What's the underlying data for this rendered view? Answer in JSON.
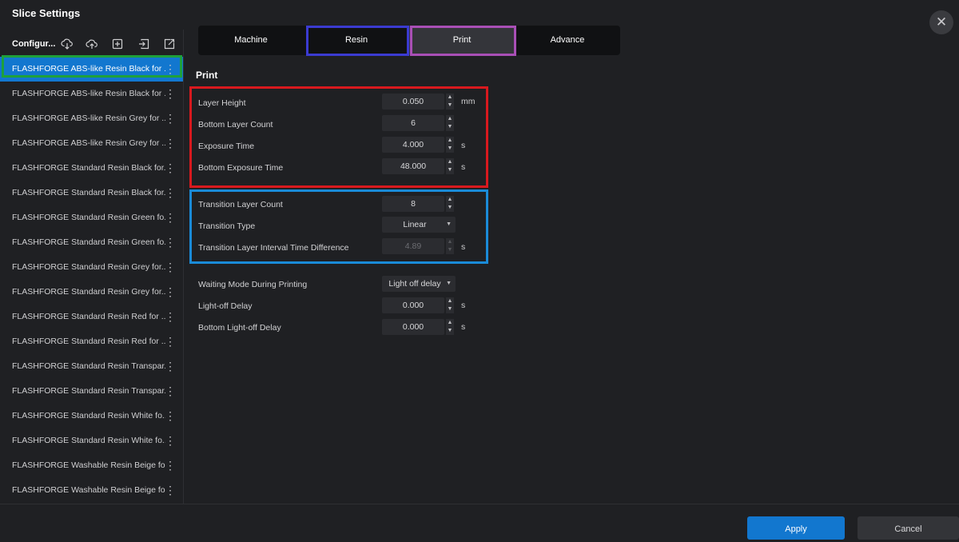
{
  "window": {
    "title": "Slice Settings",
    "close_glyph": "✕"
  },
  "sidebar": {
    "header_title": "Configur...",
    "icons": [
      "download-cloud-icon",
      "upload-cloud-icon",
      "add-config-icon",
      "import-config-icon",
      "export-config-icon"
    ],
    "items": [
      {
        "label": "FLASHFORGE ABS-like Resin Black  for ...",
        "selected": true
      },
      {
        "label": "FLASHFORGE ABS-like Resin Black  for ..."
      },
      {
        "label": "FLASHFORGE ABS-like Resin Grey  for ..."
      },
      {
        "label": "FLASHFORGE ABS-like Resin Grey  for ..."
      },
      {
        "label": "FLASHFORGE Standard Resin Black  for..."
      },
      {
        "label": "FLASHFORGE Standard Resin Black  for..."
      },
      {
        "label": "FLASHFORGE Standard Resin Green  fo..."
      },
      {
        "label": "FLASHFORGE Standard Resin Green  fo..."
      },
      {
        "label": "FLASHFORGE Standard Resin Grey  for..."
      },
      {
        "label": "FLASHFORGE Standard Resin Grey  for..."
      },
      {
        "label": "FLASHFORGE Standard Resin Red  for ..."
      },
      {
        "label": "FLASHFORGE Standard Resin Red  for ..."
      },
      {
        "label": "FLASHFORGE Standard Resin Transpar..."
      },
      {
        "label": "FLASHFORGE Standard Resin Transpar..."
      },
      {
        "label": "FLASHFORGE Standard Resin White  fo..."
      },
      {
        "label": "FLASHFORGE Standard Resin White  fo..."
      },
      {
        "label": "FLASHFORGE Washable Resin Beige  fo..."
      },
      {
        "label": "FLASHFORGE Washable Resin Beige  fo..."
      }
    ],
    "more_glyph": "⋮"
  },
  "tabs": [
    {
      "label": "Machine"
    },
    {
      "label": "Resin"
    },
    {
      "label": "Print",
      "active": true
    },
    {
      "label": "Advance"
    }
  ],
  "section_title": "Print",
  "settings": {
    "layer_height": {
      "label": "Layer Height",
      "value": "0.050",
      "unit": "mm"
    },
    "bottom_layer_count": {
      "label": "Bottom Layer Count",
      "value": "6",
      "unit": ""
    },
    "exposure_time": {
      "label": "Exposure Time",
      "value": "4.000",
      "unit": "s"
    },
    "bottom_exposure_time": {
      "label": "Bottom Exposure Time",
      "value": "48.000",
      "unit": "s"
    },
    "transition_layer_count": {
      "label": "Transition Layer Count",
      "value": "8",
      "unit": ""
    },
    "transition_type": {
      "label": "Transition Type",
      "value": "Linear"
    },
    "transition_interval": {
      "label": "Transition Layer Interval Time Difference",
      "value": "4.89",
      "unit": "s"
    },
    "waiting_mode": {
      "label": "Waiting Mode During Printing",
      "value": "Light off delay"
    },
    "light_off_delay": {
      "label": "Light-off Delay",
      "value": "0.000",
      "unit": "s"
    },
    "bottom_light_off_delay": {
      "label": "Bottom Light-off Delay",
      "value": "0.000",
      "unit": "s"
    }
  },
  "glyphs": {
    "up": "▲",
    "down": "▼",
    "dropdown": "▼"
  },
  "footer": {
    "apply_label": "Apply",
    "cancel_label": "Cancel"
  },
  "colors": {
    "accent": "#1277cf",
    "highlight_green": "#1ea03c",
    "highlight_blue": "#3b3bd1",
    "highlight_purple": "#a94fb6",
    "highlight_red": "#d8191e",
    "highlight_cyan": "#1a8bd8"
  }
}
